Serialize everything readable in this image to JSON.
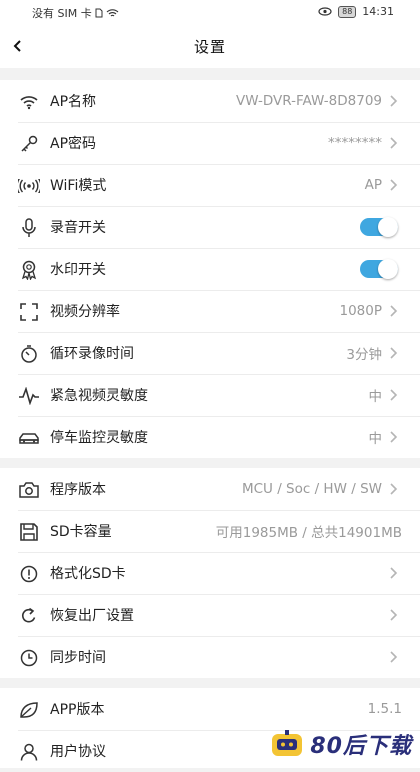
{
  "status_bar": {
    "carrier": "没有 SIM 卡",
    "battery": "88",
    "time": "14:31"
  },
  "header": {
    "title": "设置",
    "back_icon": "chevron-left-icon"
  },
  "group1": [
    {
      "icon": "wifi-icon",
      "label": "AP名称",
      "value": "VW-DVR-FAW-8D8709"
    },
    {
      "icon": "key-icon",
      "label": "AP密码",
      "value": "********"
    },
    {
      "icon": "broadcast-icon",
      "label": "WiFi模式",
      "value": "AP"
    },
    {
      "icon": "microphone-icon",
      "label": "录音开关",
      "toggle": true
    },
    {
      "icon": "medal-icon",
      "label": "水印开关",
      "toggle": true
    },
    {
      "icon": "frame-corners-icon",
      "label": "视频分辨率",
      "value": "1080P"
    },
    {
      "icon": "stopwatch-icon",
      "label": "循环录像时间",
      "value": "3分钟"
    },
    {
      "icon": "pulse-icon",
      "label": "紧急视频灵敏度",
      "value": "中"
    },
    {
      "icon": "car-icon",
      "label": "停车监控灵敏度",
      "value": "中"
    }
  ],
  "group2": [
    {
      "icon": "camera-icon",
      "label": "程序版本",
      "value": "MCU / Soc / HW / SW"
    },
    {
      "icon": "floppy-disk-icon",
      "label": "SD卡容量",
      "value": "可用1985MB / 总共14901MB"
    },
    {
      "icon": "exclamation-circle-icon",
      "label": "格式化SD卡"
    },
    {
      "icon": "refresh-icon",
      "label": "恢复出厂设置"
    },
    {
      "icon": "clock-icon",
      "label": "同步时间"
    }
  ],
  "group3": [
    {
      "icon": "leaf-icon",
      "label": "APP版本",
      "value": "1.5.1"
    },
    {
      "icon": "user-icon",
      "label": "用户协议"
    }
  ],
  "watermark": {
    "text": "80后下载"
  },
  "colors": {
    "toggle_on": "#3fa7e0",
    "value_text": "#9a9a9a",
    "background": "#f2f2f2"
  }
}
